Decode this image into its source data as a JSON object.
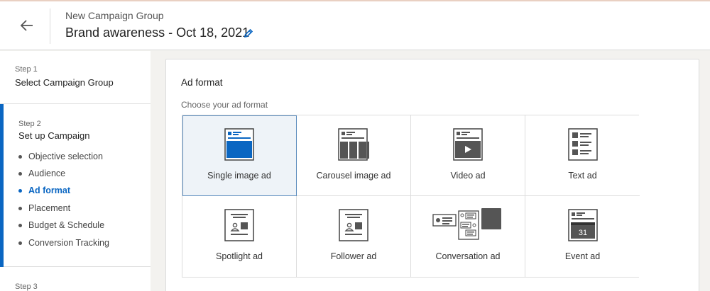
{
  "header": {
    "subtitle": "New Campaign Group",
    "title": "Brand awareness - Oct 18, 2021"
  },
  "sidebar": {
    "step1": {
      "label": "Step 1",
      "title": "Select Campaign Group"
    },
    "step2": {
      "label": "Step 2",
      "title": "Set up Campaign",
      "items": [
        {
          "label": "Objective selection"
        },
        {
          "label": "Audience"
        },
        {
          "label": "Ad format"
        },
        {
          "label": "Placement"
        },
        {
          "label": "Budget & Schedule"
        },
        {
          "label": "Conversion Tracking"
        }
      ]
    },
    "step3": {
      "label": "Step 3"
    }
  },
  "main": {
    "title": "Ad format",
    "subtitle": "Choose your ad format",
    "formats": [
      {
        "label": "Single image ad",
        "icon": "single-image-ad-icon"
      },
      {
        "label": "Carousel image ad",
        "icon": "carousel-ad-icon"
      },
      {
        "label": "Video ad",
        "icon": "video-ad-icon"
      },
      {
        "label": "Text ad",
        "icon": "text-ad-icon"
      },
      {
        "label": "Spotlight ad",
        "icon": "spotlight-ad-icon"
      },
      {
        "label": "Follower ad",
        "icon": "follower-ad-icon"
      },
      {
        "label": "Conversation ad",
        "icon": "conversation-ad-icon"
      },
      {
        "label": "Event ad",
        "icon": "event-ad-icon",
        "calendar_day": "31"
      }
    ]
  },
  "colors": {
    "accent": "#0a66c2",
    "selected_bg": "#eef3f8"
  }
}
